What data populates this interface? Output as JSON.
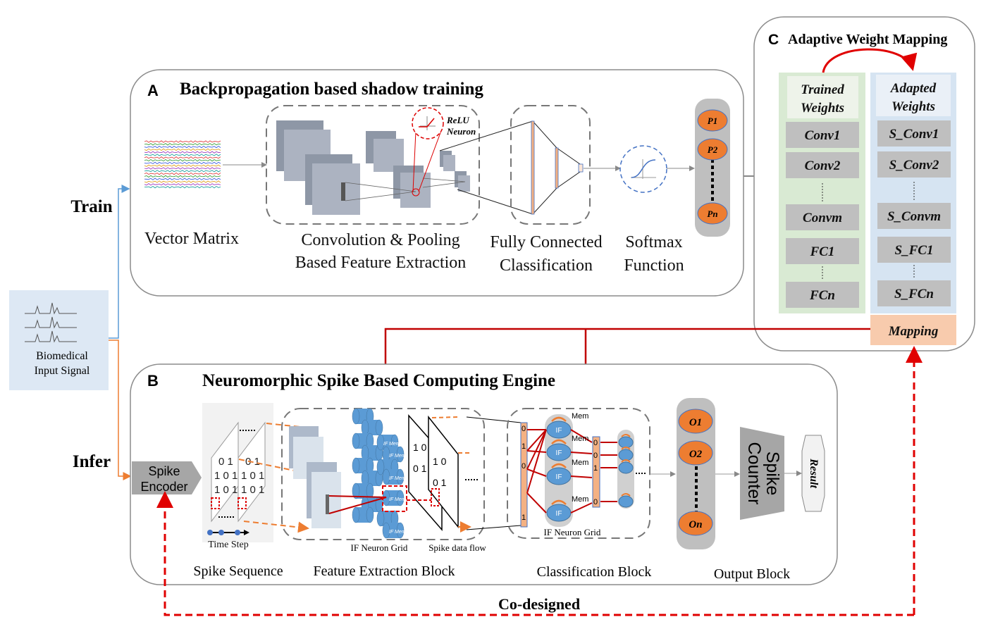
{
  "side": {
    "input_label_1": "Biomedical",
    "input_label_2": "Input Signal",
    "train": "Train",
    "infer": "Infer"
  },
  "panel_a": {
    "letter": "A",
    "title": "Backpropagation based shadow training",
    "vector_matrix": "Vector Matrix",
    "conv_1": "Convolution & Pooling",
    "conv_2": "Based Feature Extraction",
    "relu_1": "ReLU",
    "relu_2": "Neuron",
    "fc_1": "Fully Connected",
    "fc_2": "Classification",
    "softmax_1": "Softmax",
    "softmax_2": "Function",
    "outputs": [
      "P1",
      "P2",
      "Pn"
    ]
  },
  "panel_c": {
    "letter": "C",
    "title": "Adaptive Weight Mapping",
    "trained_1": "Trained",
    "trained_2": "Weights",
    "adapted_1": "Adapted",
    "adapted_2": "Weights",
    "trained": [
      "Conv1",
      "Conv2",
      "Convm",
      "FC1",
      "FCn"
    ],
    "adapted": [
      "S_Conv1",
      "S_Conv2",
      "S_Convm",
      "S_FC1",
      "S_FCn"
    ],
    "mapping": "Mapping"
  },
  "panel_b": {
    "letter": "B",
    "title": "Neuromorphic Spike Based Computing Engine",
    "encoder_1": "Spike",
    "encoder_2": "Encoder",
    "time_step": "Time Step",
    "if_grid": "IF Neuron Grid",
    "spike_flow": "Spike data flow",
    "if_grid_2": "IF Neuron Grid",
    "mem": "Mem",
    "if": "IF",
    "outputs": [
      "O1",
      "O2",
      "On"
    ],
    "spike_counter_1": "Spike",
    "spike_counter_2": "Counter",
    "result": "Result",
    "spike_sequence": "Spike Sequence",
    "feature_block": "Feature Extraction Block",
    "class_block": "Classification Block",
    "output_block": "Output Block",
    "bits_col": [
      "0",
      "1",
      "0",
      "1"
    ],
    "bits_col2": [
      "0",
      "0",
      "1",
      "0"
    ]
  },
  "codesigned": "Co-designed",
  "colors": {
    "red": "#e00000",
    "orange": "#ed7d31",
    "blue": "#5b9bd5",
    "gray": "#a6a6a6",
    "green_col": "#d9ead3",
    "blue_col": "#d6e4f2",
    "mapping": "#f8cbad"
  }
}
